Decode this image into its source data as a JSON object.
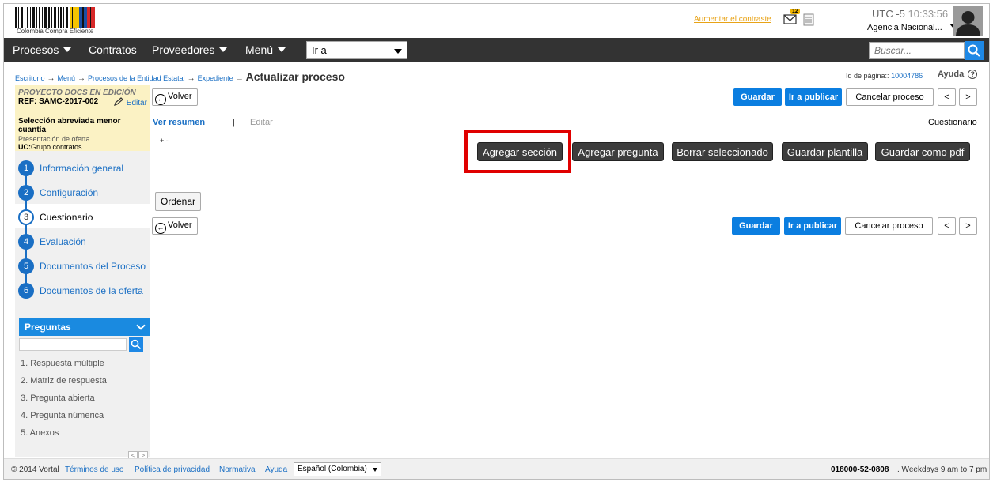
{
  "header": {
    "logo_text": "Colombia Compra Eficiente",
    "contrast_link": "Aumentar el contraste",
    "mail_count": "12",
    "clock_tz": "UTC -5",
    "clock_time": "10:33:56",
    "agency": "Agencia Nacional..."
  },
  "nav": {
    "items": [
      "Procesos",
      "Contratos",
      "Proveedores",
      "Menú"
    ],
    "goto_value": "Ir a",
    "search_placeholder": "Buscar..."
  },
  "breadcrumb": {
    "items": [
      "Escritorio",
      "Menú",
      "Procesos de la Entidad Estatal",
      "Expediente"
    ],
    "current": "Actualizar proceso",
    "page_id_label": "Id de página::",
    "page_id": "10004786",
    "help": "Ayuda"
  },
  "project": {
    "title": "PROYECTO DOCS EN EDICIÓN",
    "ref": "REF: SAMC-2017-002",
    "edit": "Editar",
    "type": "Selección abreviada menor cuantía",
    "phase": "Presentación de oferta",
    "uc_label": "UC:",
    "uc_value": "Grupo contratos"
  },
  "steps": [
    {
      "num": "1",
      "label": "Información general"
    },
    {
      "num": "2",
      "label": "Configuración"
    },
    {
      "num": "3",
      "label": "Cuestionario"
    },
    {
      "num": "4",
      "label": "Evaluación"
    },
    {
      "num": "5",
      "label": "Documentos del Proceso"
    },
    {
      "num": "6",
      "label": "Documentos de la oferta"
    }
  ],
  "preguntas": {
    "title": "Preguntas",
    "items": [
      "1. Respuesta múltiple",
      "2. Matriz de respuesta",
      "3. Pregunta abierta",
      "4. Pregunta númerica",
      "5. Anexos"
    ]
  },
  "actions": {
    "volver": "Volver",
    "guardar": "Guardar",
    "publicar": "Ir a publicar",
    "cancelar": "Cancelar proceso",
    "prev": "<",
    "next": ">"
  },
  "tabs": {
    "resumen": "Ver resumen",
    "separator": "|",
    "editar": "Editar",
    "cuestionario": "Cuestionario"
  },
  "toolbar": {
    "expand": "+ -",
    "agregar_seccion": "Agregar sección",
    "agregar_pregunta": "Agregar pregunta",
    "borrar": "Borrar seleccionado",
    "guardar_plantilla": "Guardar plantilla",
    "guardar_pdf": "Guardar como pdf",
    "ordenar": "Ordenar"
  },
  "footer": {
    "copyright": "© 2014 Vortal",
    "links": [
      "Términos de uso",
      "Política de privacidad",
      "Normativa",
      "Ayuda"
    ],
    "language": "Español (Colombia)",
    "phone": "018000-52-0808",
    "hours": ". Weekdays 9 am to 7 pm"
  },
  "colors": {
    "accent": "#0b7ee0",
    "navbar": "#333333",
    "highlight": "#e00000",
    "project_bg": "#fbf2c4"
  }
}
